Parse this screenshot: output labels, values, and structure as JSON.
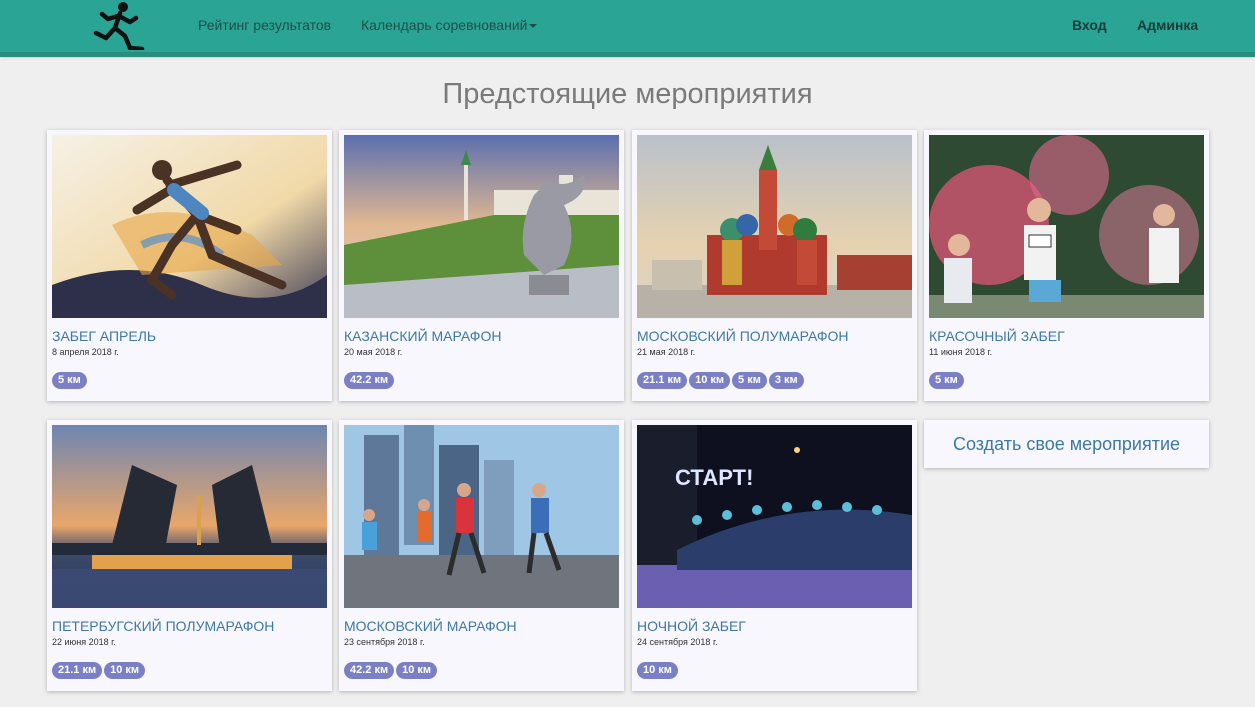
{
  "nav": {
    "links": [
      "Рейтинг результатов",
      "Календарь соревнований"
    ],
    "login": "Вход",
    "admin": "Админка"
  },
  "page_title": "Предстоящие мероприятия",
  "events": [
    {
      "title": "ЗАБЕГ АПРЕЛЬ",
      "date": "8 апреля 2018 г.",
      "distances": [
        "5 км"
      ],
      "image": "runner-painting"
    },
    {
      "title": "КАЗАНСКИЙ МАРАФОН",
      "date": "20 мая 2018 г.",
      "distances": [
        "42.2 км"
      ],
      "image": "kazan-dragon"
    },
    {
      "title": "МОСКОВСКИЙ ПОЛУМАРАФОН",
      "date": "21 мая 2018 г.",
      "distances": [
        "21.1 км",
        "10 км",
        "5 км",
        "3 км"
      ],
      "image": "st-basil-cathedral"
    },
    {
      "title": "КРАСОЧНЫЙ ЗАБЕГ",
      "date": "11 июня 2018 г.",
      "distances": [
        "5 км"
      ],
      "image": "color-run"
    },
    {
      "title": "ПЕТЕРБУГСКИЙ ПОЛУМАРАФОН",
      "date": "22 июня 2018 г.",
      "distances": [
        "21.1 км",
        "10 км"
      ],
      "image": "drawbridge"
    },
    {
      "title": "МОСКОВСКИЙ МАРАФОН",
      "date": "23 сентября 2018 г.",
      "distances": [
        "42.2 км",
        "10 км"
      ],
      "image": "moscow-city-runners"
    },
    {
      "title": "НОЧНОЙ ЗАБЕГ",
      "date": "24 сентября 2018 г.",
      "distances": [
        "10 км"
      ],
      "image": "night-run-start"
    }
  ],
  "image_text": {
    "start_sign": "СТАРТ!"
  },
  "create_event": "Создать свое мероприятие",
  "colors": {
    "navbar": "#2aa595",
    "badge": "#7b80c6",
    "link": "#3d78a8"
  }
}
